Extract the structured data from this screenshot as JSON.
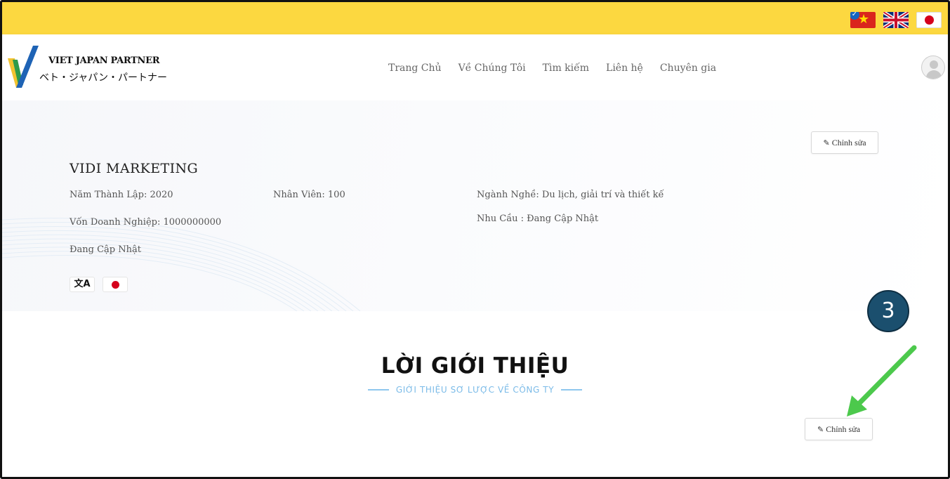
{
  "languages": {
    "vi_flag": "vietnam-flag-icon",
    "en_flag": "uk-flag-icon",
    "ja_flag": "japan-flag-icon",
    "selected_mark": "✓"
  },
  "header": {
    "logo_title": "VIET JAPAN PARTNER",
    "logo_subtitle": "ベト・ジャパン・パートナー",
    "nav": [
      "Trang Chủ",
      "Về Chúng Tôi",
      "Tìm kiếm",
      "Liên hệ",
      "Chuyên gia"
    ]
  },
  "company": {
    "name": "VIDI MARKETING",
    "founded": "Năm Thành Lập:  2020",
    "employees": "Nhân Viên:  100",
    "industry": "Ngành Nghề: Du lịch, giải trí và thiết kế",
    "capital": "Vốn Doanh Nghiệp:  1000000000",
    "needs": "Nhu Cầu : Đang Cập Nhật",
    "address": "Đang Cập Nhật",
    "translate_glyph": "文A",
    "edit_label": "Chỉnh sửa"
  },
  "intro": {
    "title": "LỜI GIỚI THIỆU",
    "subtitle": "GIỚI THIỆU SƠ LƯỢC VỀ CÔNG TY",
    "edit_label": "Chỉnh sửa"
  },
  "annotation": {
    "step": "3",
    "color": "#4cc94c"
  },
  "colors": {
    "topbar": "#fcd840",
    "accent_blue": "#7bbbe8",
    "badge": "#1b4f6e"
  }
}
